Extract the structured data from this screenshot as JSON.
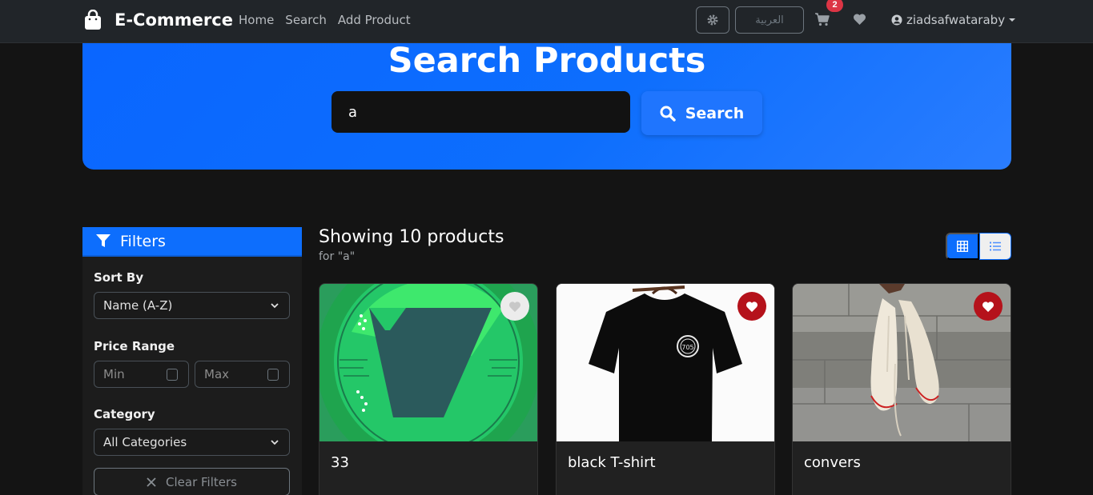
{
  "navbar": {
    "brand": "E-Commerce",
    "links": [
      "Home",
      "Search",
      "Add Product"
    ],
    "language_button": "العربية",
    "cart_count": "2",
    "username": "ziadsafwataraby"
  },
  "hero": {
    "title": "Search Products",
    "search_value": "a",
    "search_button": "Search"
  },
  "filters": {
    "header": "Filters",
    "sort_label": "Sort By",
    "sort_value": "Name (A-Z)",
    "price_label": "Price Range",
    "min_placeholder": "Min",
    "max_placeholder": "Max",
    "category_label": "Category",
    "category_value": "All Categories",
    "clear_button": "Clear Filters"
  },
  "results": {
    "title": "Showing 10 products",
    "subtitle": "for \"a\"",
    "view_mode": "grid"
  },
  "products": [
    {
      "name": "33",
      "favorited": false
    },
    {
      "name": "black T-shirt",
      "favorited": true
    },
    {
      "name": "convers",
      "favorited": true
    }
  ],
  "colors": {
    "accent": "#0d6efd",
    "badge": "#dc3545",
    "favorite": "#b5121b",
    "background": "#141414"
  }
}
